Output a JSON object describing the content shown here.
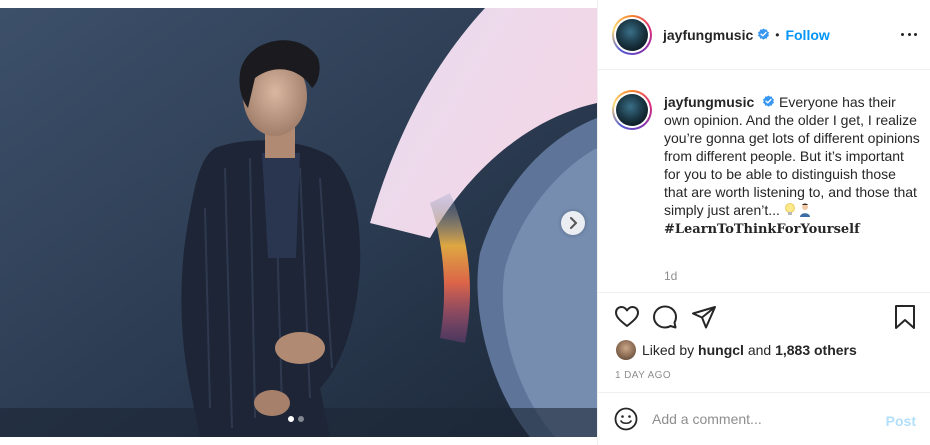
{
  "post": {
    "username": "jayfungmusic",
    "follow_label": "Follow",
    "separator": "•",
    "caption_text": "Everyone has their own opinion. And the older I get, I realize you’re gonna get lots of different opinions from different people. But it’s important for you to be able to distinguish those that are worth listening to, and those that simply just aren’t...",
    "hashtag": "#LearnToThinkForYourself",
    "caption_age": "1d",
    "liked_by_prefix": "Liked by",
    "liked_by_user": "hungcl",
    "liked_by_and": "and",
    "liked_by_others": "1,883 others",
    "date": "1 DAY AGO"
  },
  "comment": {
    "placeholder": "Add a comment...",
    "post_label": "Post"
  },
  "carousel": {
    "current_slide": 1,
    "total_slides": 2
  },
  "colors": {
    "link_blue": "#0095f6",
    "post_disabled": "#b2dffc",
    "verified_blue": "#3897f0"
  },
  "icons": {
    "verified": "verified-badge-icon",
    "more": "more-options-icon",
    "like": "heart-icon",
    "comment": "comment-icon",
    "share": "share-icon",
    "save": "bookmark-icon",
    "emoji": "emoji-icon",
    "next": "chevron-right-icon"
  }
}
